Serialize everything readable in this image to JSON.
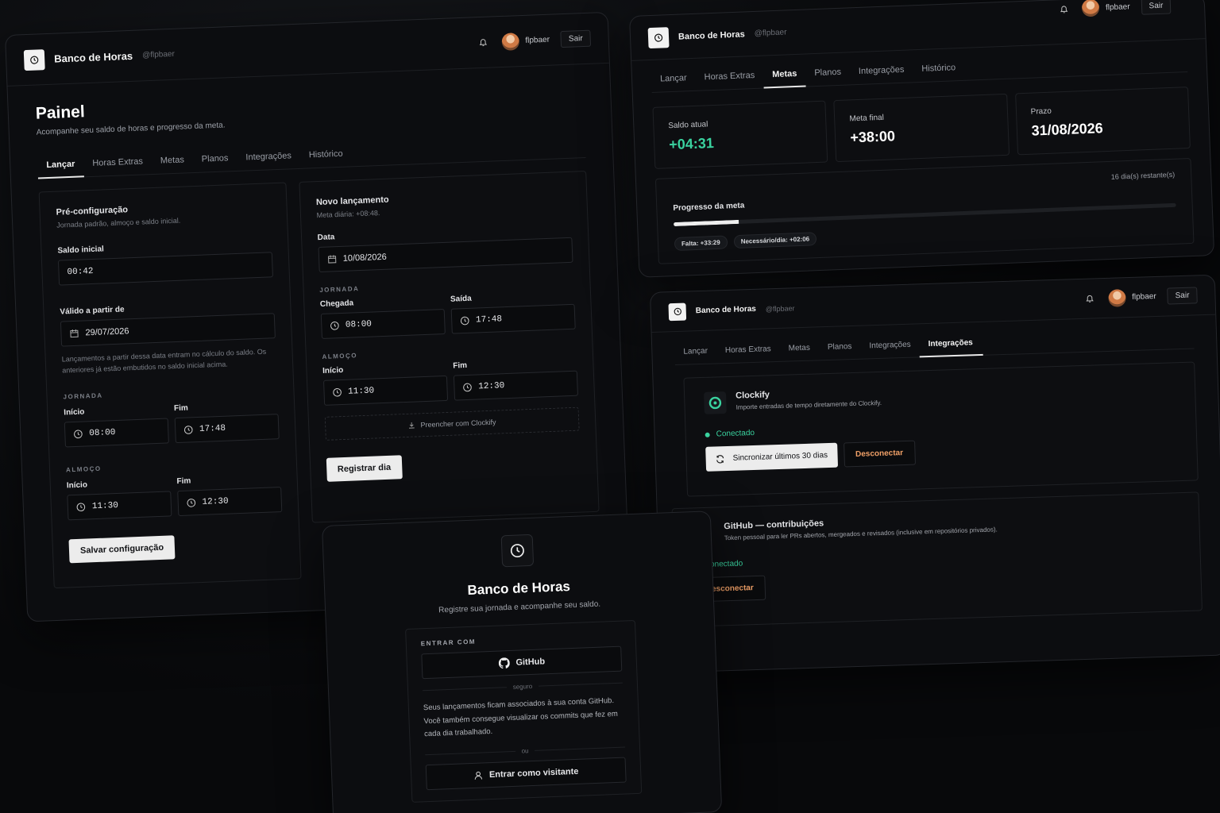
{
  "app": {
    "brand": "Banco de Horas",
    "handle": "@flpbaer",
    "user": "flpbaer",
    "logout": "Sair"
  },
  "tabs": [
    "Lançar",
    "Horas Extras",
    "Metas",
    "Planos",
    "Integrações",
    "Histórico"
  ],
  "dashboard": {
    "title": "Painel",
    "subtitle": "Acompanhe seu saldo de horas e progresso da meta.",
    "preconfig": {
      "title": "Pré-configuração",
      "subtitle": "Jornada padrão, almoço e saldo inicial.",
      "saldo_label": "Saldo inicial",
      "saldo_value": "00:42",
      "valid_label": "Válido a partir de",
      "valid_value": "29/07/2026",
      "valid_note": "Lançamentos a partir dessa data entram no cálculo do saldo. Os anteriores já estão embutidos no saldo inicial acima.",
      "jornada_section": "JORNADA",
      "inicio_label": "Início",
      "fim_label": "Fim",
      "jornada_inicio": "08:00",
      "jornada_fim": "17:48",
      "almoco_section": "ALMOÇO",
      "almoco_inicio": "11:30",
      "almoco_fim": "12:30",
      "save_button": "Salvar configuração"
    },
    "novo": {
      "title": "Novo lançamento",
      "subtitle": "Meta diária: +08:48.",
      "data_label": "Data",
      "data_value": "10/08/2026",
      "jornada_section": "JORNADA",
      "chegada_label": "Chegada",
      "chegada_value": "08:00",
      "saida_label": "Saída",
      "saida_value": "17:48",
      "almoco_section": "ALMOÇO",
      "inicio_label": "Início",
      "inicio_value": "11:30",
      "fim_label": "Fim",
      "fim_value": "12:30",
      "clockify_fill": "Preencher com Clockify",
      "register_button": "Registrar dia"
    }
  },
  "metas": {
    "saldo_label": "Saldo atual",
    "saldo_value": "+04:31",
    "meta_label": "Meta final",
    "meta_value": "+38:00",
    "prazo_label": "Prazo",
    "prazo_value": "31/08/2026",
    "days_left": "16 dia(s) restante(s)",
    "progress_label": "Progresso da meta",
    "progress": 0.13,
    "falta": "Falta: +33:29",
    "necessario": "Necessário/dia: +02:06"
  },
  "integracoes": {
    "tab_label": "Integrações",
    "clockify": {
      "name": "Clockify",
      "desc": "Importe entradas de tempo diretamente do Clockify.",
      "status": "Conectado",
      "sync": "Sincronizar últimos 30 dias",
      "disconnect": "Desconectar"
    },
    "github": {
      "name": "GitHub — contribuições",
      "desc": "Token pessoal para ler PRs abertos, mergeados e revisados (inclusive em repositórios privados).",
      "status": "Conectado",
      "disconnect": "Desconectar"
    }
  },
  "login": {
    "title": "Banco de Horas",
    "subtitle": "Registre sua jornada e acompanhe seu saldo.",
    "enter_with": "ENTRAR COM",
    "github_button": "GitHub",
    "secure": "seguro",
    "info": "Seus lançamentos ficam associados à sua conta GitHub. Você também consegue visualizar os commits que fez em cada dia trabalhado.",
    "or": "ou",
    "guest_button": "Entrar como visitante"
  },
  "colors": {
    "accent_green": "#3ad29f",
    "accent_orange": "#f0a067",
    "background": "#08090b"
  }
}
